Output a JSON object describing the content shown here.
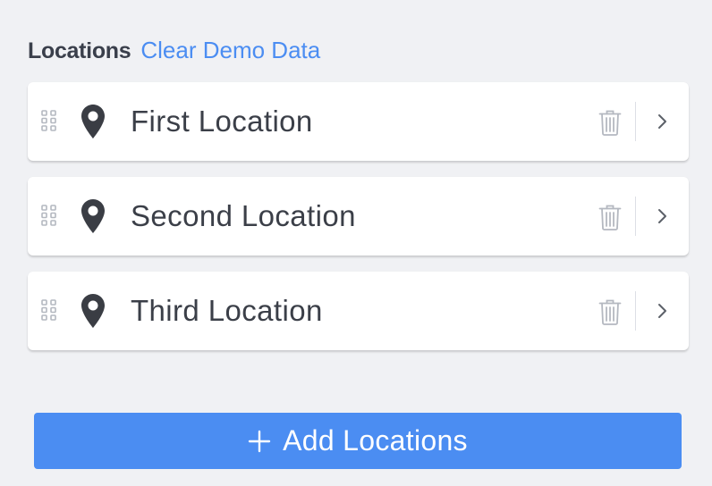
{
  "header": {
    "title": "Locations",
    "clear_link": "Clear Demo Data"
  },
  "locations": [
    {
      "label": "First Location"
    },
    {
      "label": "Second Location"
    },
    {
      "label": "Third Location"
    }
  ],
  "add_button": {
    "label": "Add Locations",
    "icon": "plus-icon"
  },
  "icons": {
    "drag": "drag-handle-icon",
    "pin": "map-pin-icon",
    "delete": "trash-icon",
    "open": "chevron-right-icon"
  },
  "colors": {
    "background": "#f0f1f4",
    "accent": "#4b8df2",
    "text": "#3b3f48",
    "icon_muted": "#b4b8c0"
  }
}
